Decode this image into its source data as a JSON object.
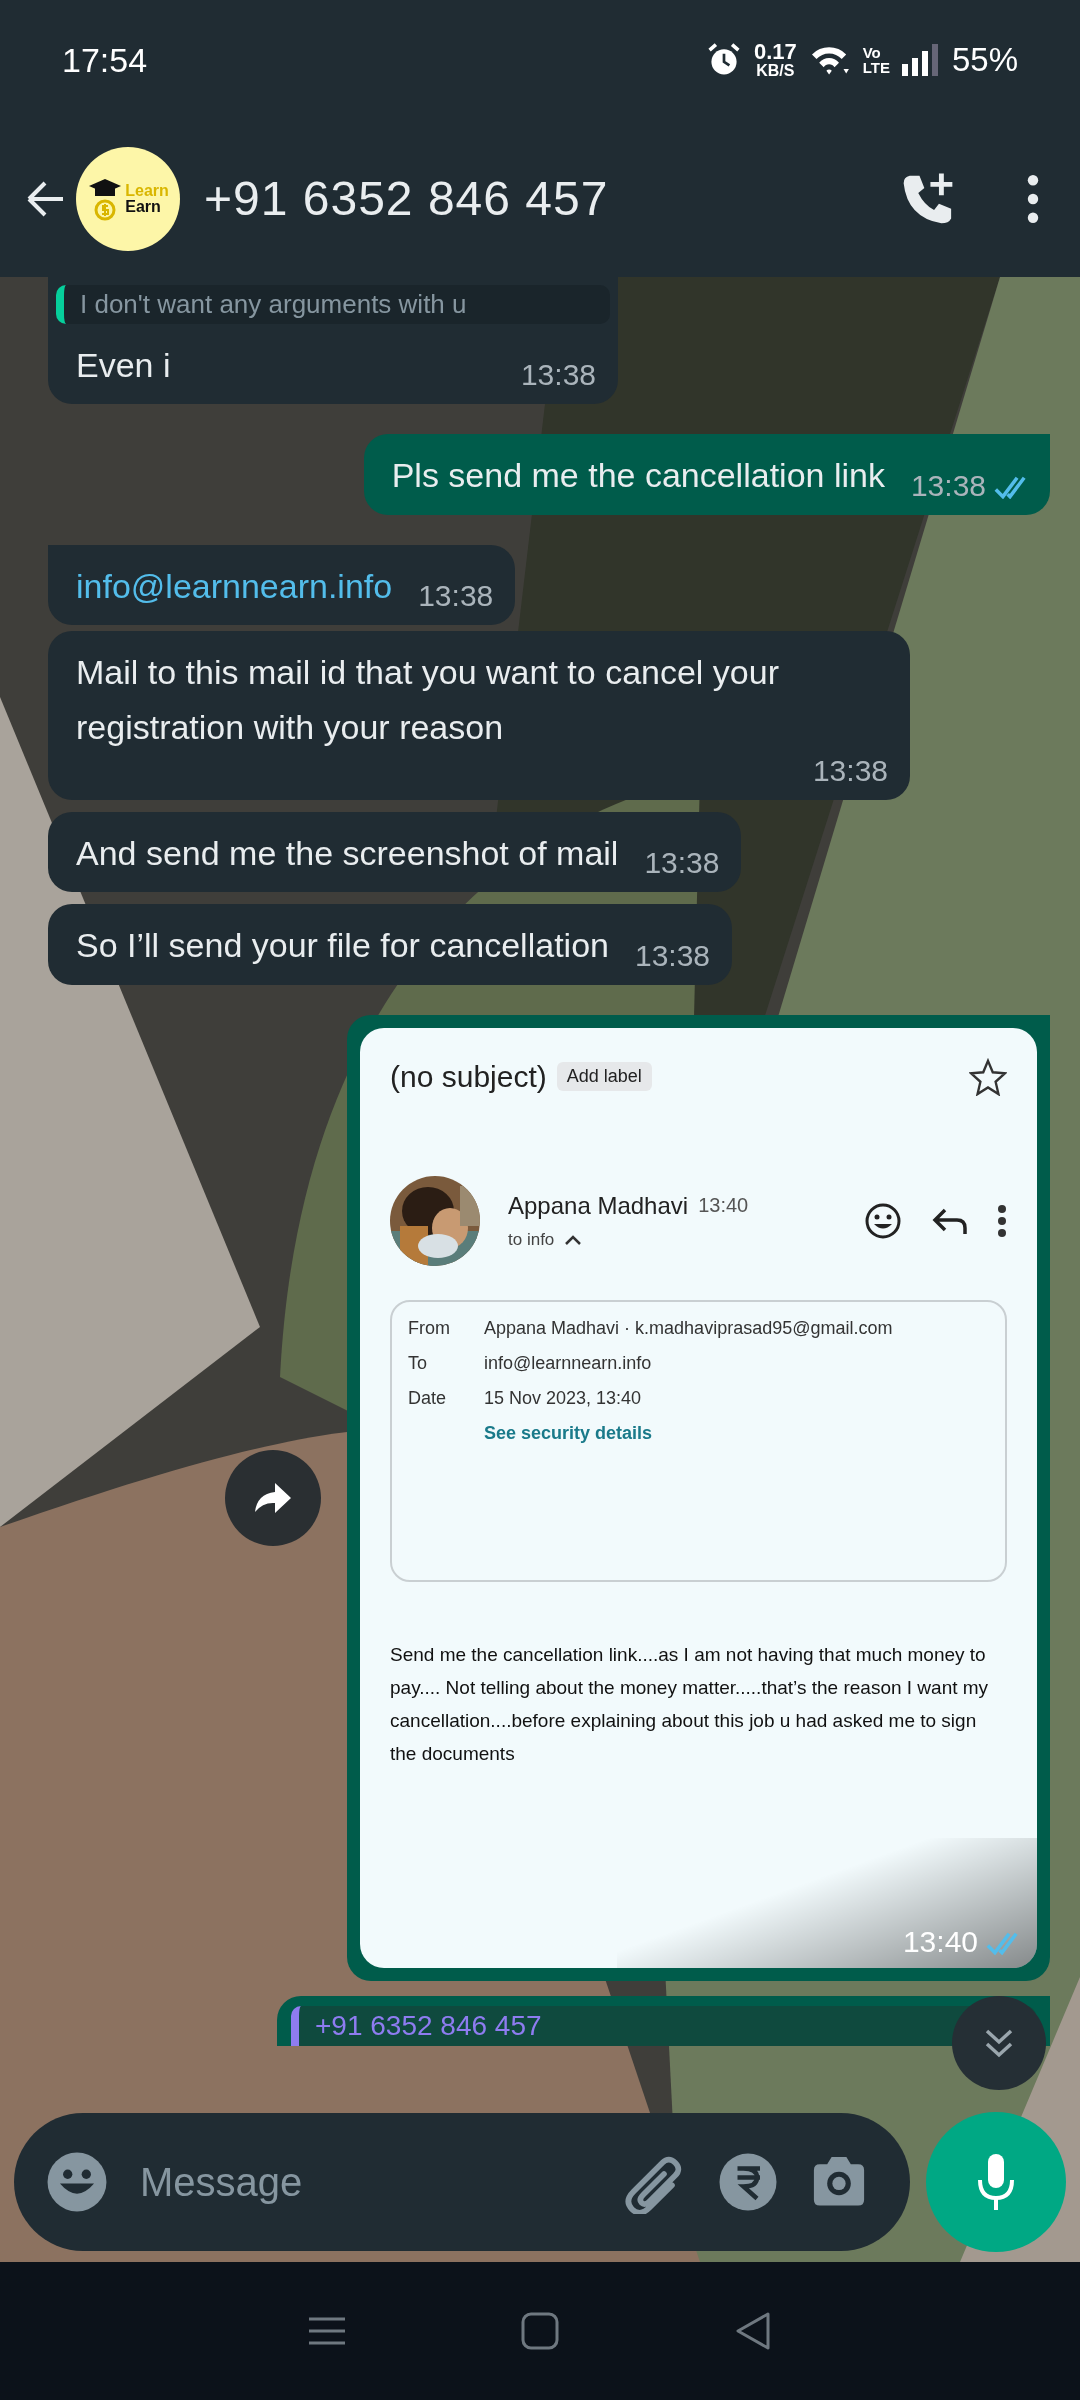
{
  "status_bar": {
    "time": "17:54",
    "net_speed": "0.17",
    "net_unit": "KB/S",
    "volte_top": "Vo",
    "volte_bottom": "LTE",
    "battery": "55%"
  },
  "header": {
    "avatar_top": "Learn",
    "avatar_bottom": "Earn",
    "title": "+91 6352 846 457"
  },
  "messages": [
    {
      "kind": "text",
      "outgoing": false,
      "quote": "I don't want any arguments with u",
      "text": "Even i",
      "time": "13:38"
    },
    {
      "kind": "text",
      "outgoing": true,
      "text": "Pls send me the cancellation link",
      "time": "13:38",
      "read": true
    },
    {
      "kind": "link",
      "outgoing": false,
      "text": "info@learnnearn.info",
      "time": "13:38"
    },
    {
      "kind": "text",
      "outgoing": false,
      "text": "Mail to this mail id that you want to cancel your registration with your reason",
      "time": "13:38"
    },
    {
      "kind": "text",
      "outgoing": false,
      "text": "And send me the screenshot of mail",
      "time": "13:38"
    },
    {
      "kind": "text",
      "outgoing": false,
      "text": "So I’ll send your file for cancellation",
      "time": "13:38"
    },
    {
      "outgoing": true,
      "time": "13:40",
      "read": true,
      "email": {
        "subject": "(no subject)",
        "label_button": "Add label",
        "starred": false,
        "sender": "Appana Madhavi",
        "sent_time": "13:40",
        "recipient": "to info",
        "details_expanded": true,
        "details": [
          {
            "label": "From",
            "value": "Appana Madhavi · k.madhaviprasad95@gmail.com"
          },
          {
            "label": "To",
            "value": "info@learnnearn.info"
          },
          {
            "label": "Date",
            "value": "15 Nov 2023, 13:40"
          }
        ],
        "security_link": "See security details",
        "body": "Send me the cancellation link....as I am not having that much money to pay.... Not telling about the money matter.....that’s the reason I want my cancellation....before explaining about this job u had asked me to sign the documents"
      }
    },
    {
      "kind": "quote_only",
      "outgoing": true,
      "quote": "+91 6352 846 457"
    }
  ],
  "composer": {
    "placeholder": "Message"
  }
}
